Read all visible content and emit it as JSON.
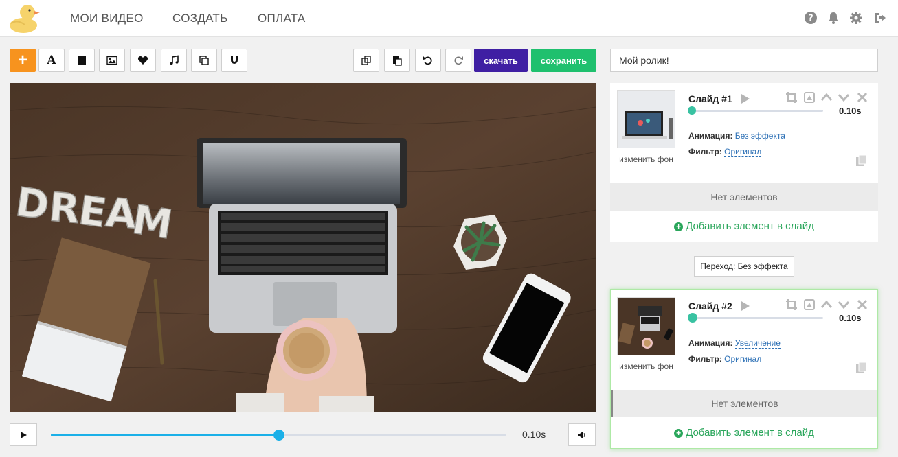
{
  "nav": {
    "items": [
      "МОИ ВИДЕО",
      "СОЗДАТЬ",
      "ОПЛАТА"
    ]
  },
  "header_icons": [
    "help-icon",
    "bell-icon",
    "gear-icon",
    "logout-icon"
  ],
  "toolbar": {
    "add_label": "+",
    "text_label": "A",
    "download_label": "скачать",
    "save_label": "сохранить",
    "accent_color": "#f7931e",
    "download_color": "#3f1fa3",
    "save_color": "#1fc06e"
  },
  "player": {
    "time": "0.10s",
    "progress": 0.5
  },
  "project": {
    "name": "Мой ролик!"
  },
  "slides": [
    {
      "title": "Слайд #1",
      "time": "0.10s",
      "change_bg": "изменить фон",
      "animation_label": "Анимация:",
      "animation_value": "Без эффекта",
      "filter_label": "Фильтр:",
      "filter_value": "Оригинал",
      "empty_text": "Нет элементов",
      "add_element": "Добавить элемент в слайд"
    },
    {
      "title": "Слайд #2",
      "time": "0.10s",
      "change_bg": "изменить фон",
      "animation_label": "Анимация:",
      "animation_value": "Увеличение",
      "filter_label": "Фильтр:",
      "filter_value": "Оригинал",
      "empty_text": "Нет элементов",
      "add_element": "Добавить элемент в слайд"
    }
  ],
  "transition": {
    "label": "Переход: Без эффекта"
  },
  "canvas": {
    "word": "DREAM"
  }
}
